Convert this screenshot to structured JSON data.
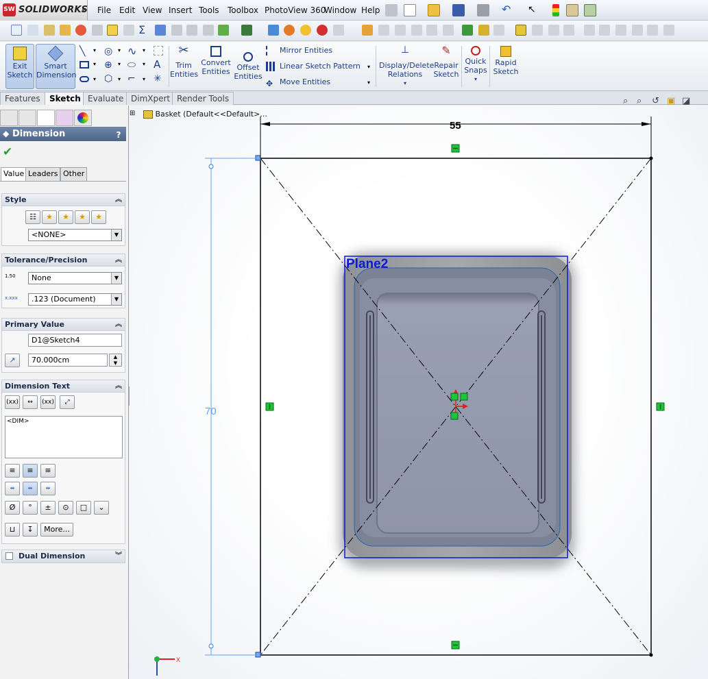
{
  "app": {
    "name": "SOLIDWORKS",
    "logo_mark": "SW"
  },
  "menu": [
    "File",
    "Edit",
    "View",
    "Insert",
    "Tools",
    "Toolbox",
    "PhotoView 360",
    "Window",
    "Help"
  ],
  "command_manager": {
    "exit_sketch": "Exit Sketch",
    "smart_dimension": "Smart Dimension",
    "trim_entities": "Trim Entities",
    "convert_entities": "Convert Entities",
    "offset_entities": "Offset Entities",
    "mirror_entities": "Mirror Entities",
    "linear_sketch_pattern": "Linear Sketch Pattern",
    "move_entities": "Move Entities",
    "display_delete_relations": "Display/Delete Relations",
    "repair_sketch": "Repair Sketch",
    "quick_snaps": "Quick Snaps",
    "rapid_sketch": "Rapid Sketch"
  },
  "tabs": [
    "Features",
    "Sketch",
    "Evaluate",
    "DimXpert",
    "Render Tools"
  ],
  "active_tab": "Sketch",
  "property_manager": {
    "title": "Dimension",
    "help": "?",
    "subtabs": [
      "Value",
      "Leaders",
      "Other"
    ],
    "style": {
      "header": "Style",
      "value": "<NONE>"
    },
    "tolerance": {
      "header": "Tolerance/Precision",
      "tol_type": "None",
      "precision": ".123 (Document)",
      "tol_icon_text": "1.50",
      "prec_icon_text": "x.xxx"
    },
    "primary_value": {
      "header": "Primary Value",
      "name": "D1@Sketch4",
      "value": "70.000cm"
    },
    "dimension_text": {
      "header": "Dimension Text",
      "text": "<DIM>",
      "more": "More...",
      "btn_xx": "(xx)",
      "btn_diam": "Ø",
      "btn_deg": "°",
      "btn_pm": "±"
    },
    "dual_dimension": {
      "header": "Dual Dimension"
    }
  },
  "feature_tree": {
    "root": "Basket  (Default<<Default>..."
  },
  "graphics": {
    "dim_horizontal": "55",
    "dim_vertical": "70",
    "plane_label": "Plane2",
    "colors": {
      "sketch": "#000000",
      "dim_blue": "#5aa2ff",
      "plane": "#0a1ad6",
      "relation": "#1ec43a"
    }
  },
  "icons": [
    "new-file-icon",
    "open-folder-icon",
    "save-icon",
    "print-icon",
    "undo-icon",
    "select-icon",
    "rebuild-icon",
    "file-properties-icon",
    "options-icon",
    "zoom-to-fit-icon",
    "zoom-area-icon",
    "previous-view-icon",
    "section-view-icon",
    "view-orientation-icon"
  ]
}
